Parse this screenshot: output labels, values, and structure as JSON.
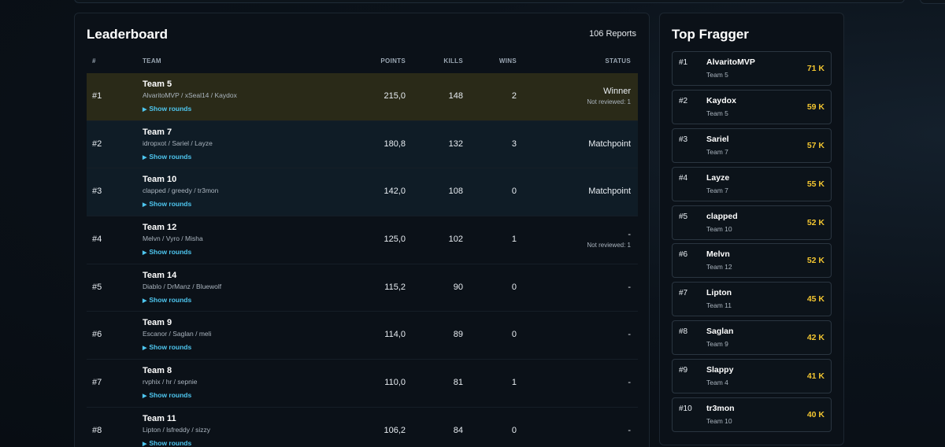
{
  "colors": {
    "accent_link": "#4ec6ef",
    "kills_gold": "#f2c530",
    "winner_row": "#2a2a18",
    "matchpoint_row": "#0f1c26"
  },
  "leaderboard": {
    "title": "Leaderboard",
    "reports": "106 Reports",
    "headers": {
      "rank": "#",
      "team": "TEAM",
      "points": "POINTS",
      "kills": "KILLS",
      "wins": "WINS",
      "status": "STATUS"
    },
    "show_rounds_label": "Show rounds",
    "rows": [
      {
        "rank": "#1",
        "team": "Team 5",
        "players": "AlvaritoMVP / xSeal14 / Kaydox",
        "points": "215,0",
        "kills": "148",
        "wins": "2",
        "status": "Winner",
        "note": "Not reviewed: 1",
        "variant": "winner"
      },
      {
        "rank": "#2",
        "team": "Team 7",
        "players": "idropxot / Sariel / Layze",
        "points": "180,8",
        "kills": "132",
        "wins": "3",
        "status": "Matchpoint",
        "note": "",
        "variant": "match"
      },
      {
        "rank": "#3",
        "team": "Team 10",
        "players": "clapped / greedy / tr3mon",
        "points": "142,0",
        "kills": "108",
        "wins": "0",
        "status": "Matchpoint",
        "note": "",
        "variant": "match"
      },
      {
        "rank": "#4",
        "team": "Team 12",
        "players": "Melvn / Vyro / Misha",
        "points": "125,0",
        "kills": "102",
        "wins": "1",
        "status": "-",
        "note": "Not reviewed: 1",
        "variant": ""
      },
      {
        "rank": "#5",
        "team": "Team 14",
        "players": "Diablo / DrManz / Bluewolf",
        "points": "115,2",
        "kills": "90",
        "wins": "0",
        "status": "-",
        "note": "",
        "variant": ""
      },
      {
        "rank": "#6",
        "team": "Team 9",
        "players": "Escanor / Saglan / meli",
        "points": "114,0",
        "kills": "89",
        "wins": "0",
        "status": "-",
        "note": "",
        "variant": ""
      },
      {
        "rank": "#7",
        "team": "Team 8",
        "players": "rvphix / hr / sepnie",
        "points": "110,0",
        "kills": "81",
        "wins": "1",
        "status": "-",
        "note": "",
        "variant": ""
      },
      {
        "rank": "#8",
        "team": "Team 11",
        "players": "Lipton / lsfreddy / sizzy",
        "points": "106,2",
        "kills": "84",
        "wins": "0",
        "status": "-",
        "note": "",
        "variant": ""
      }
    ]
  },
  "top_fragger": {
    "title": "Top Fragger",
    "items": [
      {
        "rank": "#1",
        "name": "AlvaritoMVP",
        "team": "Team 5",
        "kills": "71 K"
      },
      {
        "rank": "#2",
        "name": "Kaydox",
        "team": "Team 5",
        "kills": "59 K"
      },
      {
        "rank": "#3",
        "name": "Sariel",
        "team": "Team 7",
        "kills": "57 K"
      },
      {
        "rank": "#4",
        "name": "Layze",
        "team": "Team 7",
        "kills": "55 K"
      },
      {
        "rank": "#5",
        "name": "clapped",
        "team": "Team 10",
        "kills": "52 K"
      },
      {
        "rank": "#6",
        "name": "Melvn",
        "team": "Team 12",
        "kills": "52 K"
      },
      {
        "rank": "#7",
        "name": "Lipton",
        "team": "Team 11",
        "kills": "45 K"
      },
      {
        "rank": "#8",
        "name": "Saglan",
        "team": "Team 9",
        "kills": "42 K"
      },
      {
        "rank": "#9",
        "name": "Slappy",
        "team": "Team 4",
        "kills": "41 K"
      },
      {
        "rank": "#10",
        "name": "tr3mon",
        "team": "Team 10",
        "kills": "40 K"
      }
    ]
  }
}
